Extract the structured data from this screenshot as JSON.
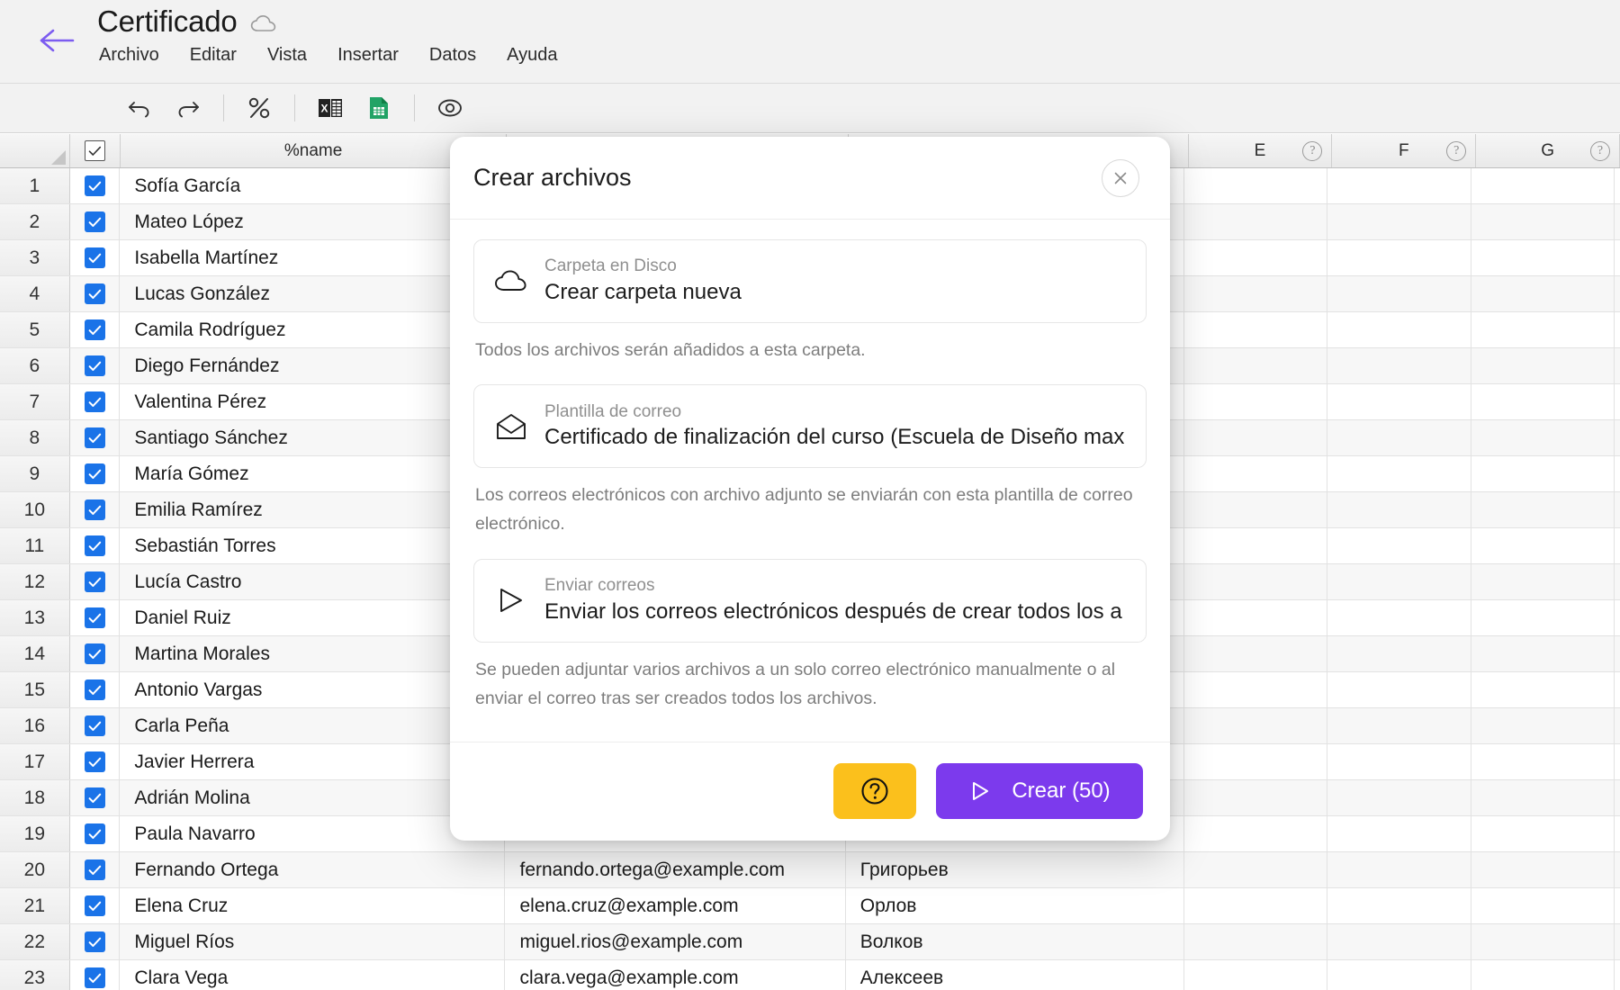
{
  "window": {
    "title": "Certificado",
    "back_icon": "arrow-left-icon",
    "cloud_icon": "cloud-icon"
  },
  "menubar": {
    "items": [
      {
        "label": "Archivo"
      },
      {
        "label": "Editar"
      },
      {
        "label": "Vista"
      },
      {
        "label": "Insertar"
      },
      {
        "label": "Datos"
      },
      {
        "label": "Ayuda"
      }
    ]
  },
  "toolbar": {
    "buttons": [
      {
        "name": "undo-icon",
        "title": "Deshacer"
      },
      {
        "name": "redo-icon",
        "title": "Rehacer"
      },
      {
        "name": "percent-icon",
        "title": "Porcentaje"
      },
      {
        "name": "excel-icon",
        "title": "Excel"
      },
      {
        "name": "sheets-icon",
        "title": "Google Sheets"
      },
      {
        "name": "eye-icon",
        "title": "Vista previa"
      }
    ]
  },
  "sheet": {
    "columns": [
      {
        "key": "rownum",
        "label": ""
      },
      {
        "key": "check",
        "label": ""
      },
      {
        "key": "name",
        "label": "%name"
      },
      {
        "key": "email",
        "label": ""
      },
      {
        "key": "d",
        "label": ""
      },
      {
        "key": "e",
        "label": "E"
      },
      {
        "key": "f",
        "label": "F"
      },
      {
        "key": "g",
        "label": "G"
      }
    ],
    "rows": [
      {
        "n": "1",
        "checked": true,
        "name": "Sofía García",
        "email": "",
        "d": ""
      },
      {
        "n": "2",
        "checked": true,
        "name": "Mateo López",
        "email": "",
        "d": ""
      },
      {
        "n": "3",
        "checked": true,
        "name": "Isabella Martínez",
        "email": "",
        "d": ""
      },
      {
        "n": "4",
        "checked": true,
        "name": "Lucas González",
        "email": "",
        "d": ""
      },
      {
        "n": "5",
        "checked": true,
        "name": "Camila Rodríguez",
        "email": "",
        "d": ""
      },
      {
        "n": "6",
        "checked": true,
        "name": "Diego Fernández",
        "email": "",
        "d": ""
      },
      {
        "n": "7",
        "checked": true,
        "name": "Valentina Pérez",
        "email": "",
        "d": ""
      },
      {
        "n": "8",
        "checked": true,
        "name": "Santiago Sánchez",
        "email": "",
        "d": ""
      },
      {
        "n": "9",
        "checked": true,
        "name": "María Gómez",
        "email": "",
        "d": ""
      },
      {
        "n": "10",
        "checked": true,
        "name": "Emilia Ramírez",
        "email": "",
        "d": ""
      },
      {
        "n": "11",
        "checked": true,
        "name": "Sebastián Torres",
        "email": "",
        "d": ""
      },
      {
        "n": "12",
        "checked": true,
        "name": "Lucía Castro",
        "email": "",
        "d": ""
      },
      {
        "n": "13",
        "checked": true,
        "name": "Daniel Ruiz",
        "email": "",
        "d": ""
      },
      {
        "n": "14",
        "checked": true,
        "name": "Martina Morales",
        "email": "",
        "d": ""
      },
      {
        "n": "15",
        "checked": true,
        "name": "Antonio Vargas",
        "email": "",
        "d": ""
      },
      {
        "n": "16",
        "checked": true,
        "name": "Carla Peña",
        "email": "",
        "d": ""
      },
      {
        "n": "17",
        "checked": true,
        "name": "Javier Herrera",
        "email": "",
        "d": ""
      },
      {
        "n": "18",
        "checked": true,
        "name": "Adrián Molina",
        "email": "",
        "d": ""
      },
      {
        "n": "19",
        "checked": true,
        "name": "Paula Navarro",
        "email": "",
        "d": ""
      },
      {
        "n": "20",
        "checked": true,
        "name": "Fernando Ortega",
        "email": "fernando.ortega@example.com",
        "d": "Григорьев"
      },
      {
        "n": "21",
        "checked": true,
        "name": "Elena Cruz",
        "email": "elena.cruz@example.com",
        "d": "Орлов"
      },
      {
        "n": "22",
        "checked": true,
        "name": "Miguel Ríos",
        "email": "miguel.rios@example.com",
        "d": "Волков"
      },
      {
        "n": "23",
        "checked": true,
        "name": "Clara Vega",
        "email": "clara.vega@example.com",
        "d": "Алексеев"
      }
    ]
  },
  "dialog": {
    "title": "Crear archivos",
    "close_icon": "close-icon",
    "options": [
      {
        "icon": "cloud-icon",
        "label": "Carpeta en Disco",
        "value": "Crear carpeta nueva",
        "description": "Todos los archivos serán añadidos a esta carpeta."
      },
      {
        "icon": "envelope-icon",
        "label": "Plantilla de correo",
        "value": "Certificado de finalización del curso (Escuela de Diseño max",
        "description": "Los correos electrónicos con archivo adjunto se enviarán con esta plantilla de correo electrónico."
      },
      {
        "icon": "send-icon",
        "label": "Enviar correos",
        "value": "Enviar los correos electrónicos después de crear todos los a",
        "description": "Se pueden adjuntar varios archivos a un solo correo electrónico manualmente o al enviar el correo tras ser creados todos los archivos."
      }
    ],
    "footer": {
      "help_icon": "question-circle-icon",
      "create_icon": "play-triangle-icon",
      "create_label": "Crear (50)"
    }
  },
  "colors": {
    "accent_purple": "#7c3aed",
    "help_yellow": "#fbc01c",
    "checkbox_blue": "#1a73e8",
    "sheets_green": "#21a366"
  }
}
